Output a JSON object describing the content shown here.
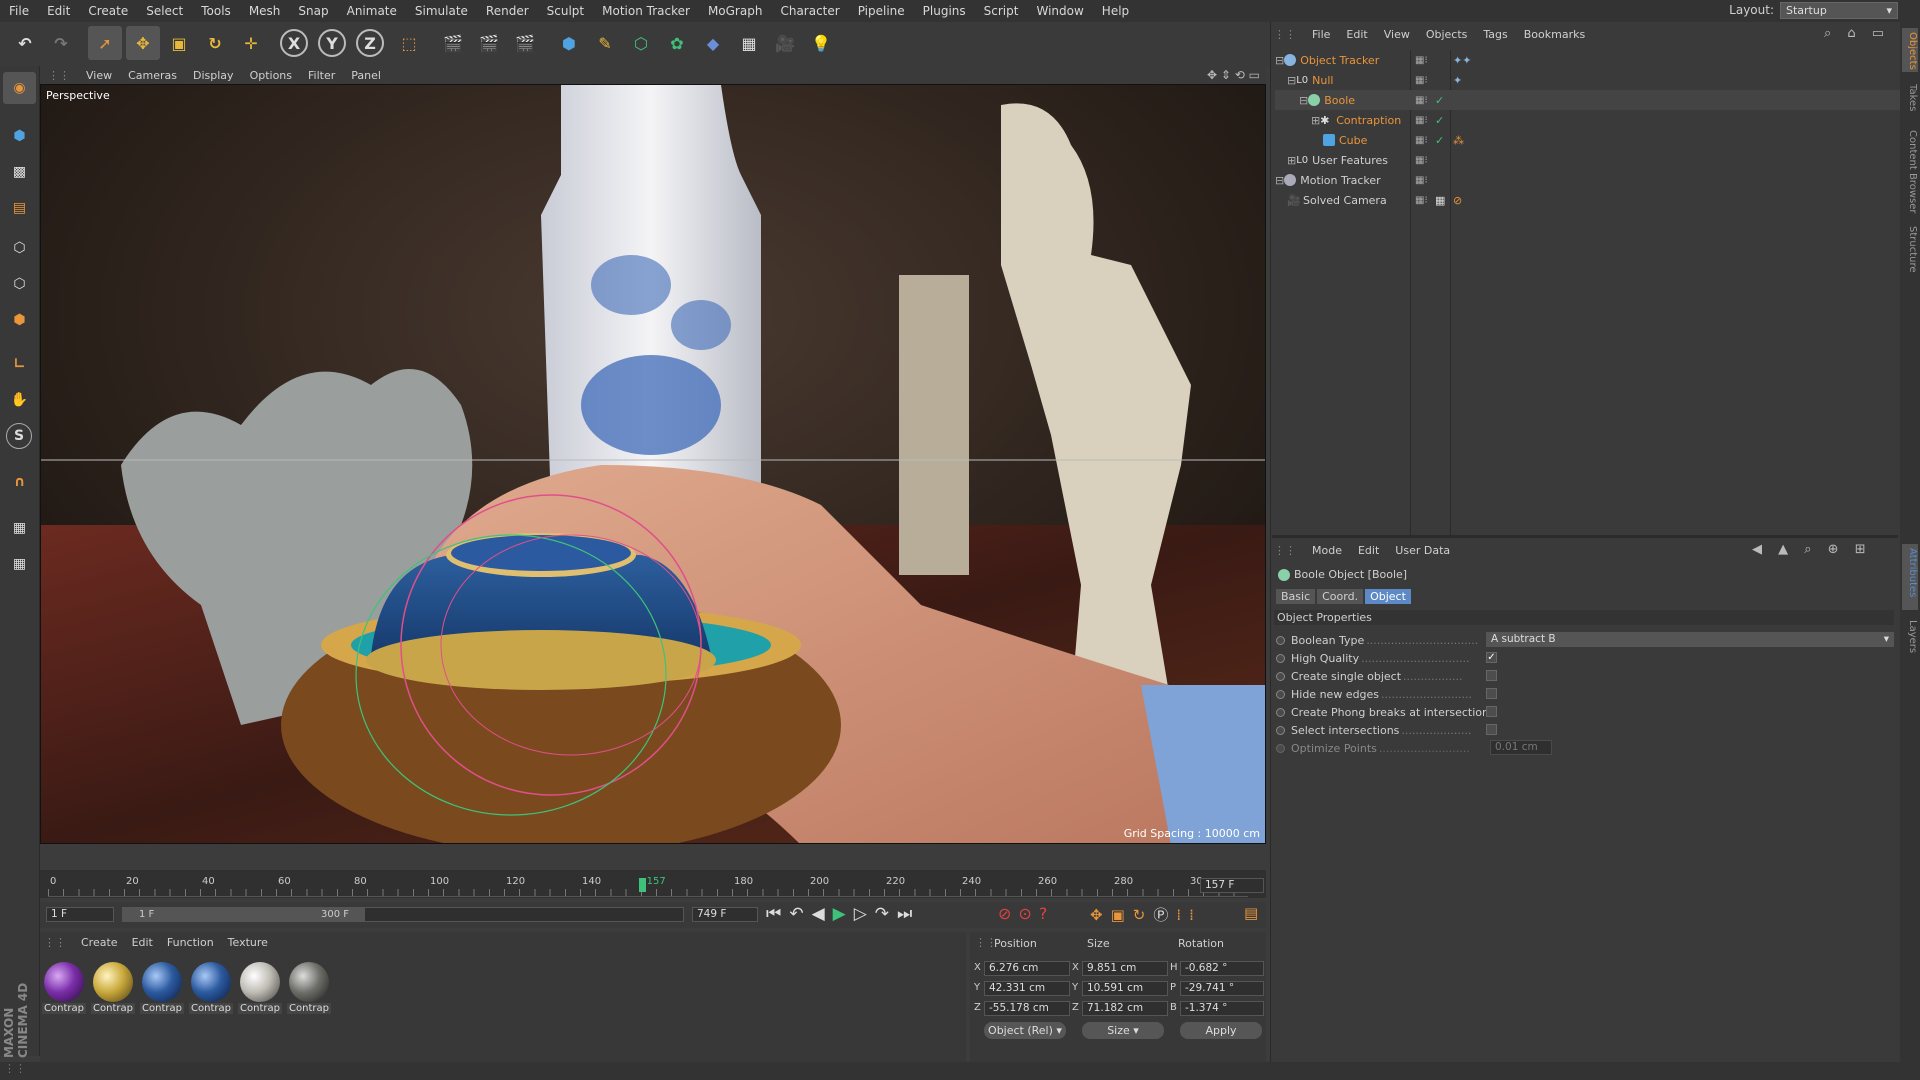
{
  "menubar": {
    "items": [
      "File",
      "Edit",
      "Create",
      "Select",
      "Tools",
      "Mesh",
      "Snap",
      "Animate",
      "Simulate",
      "Render",
      "Sculpt",
      "Motion Tracker",
      "MoGraph",
      "Character",
      "Pipeline",
      "Plugins",
      "Script",
      "Window",
      "Help"
    ],
    "layout_label": "Layout:",
    "layout_value": "Startup"
  },
  "toolbar": {
    "x_label": "X",
    "y_label": "Y",
    "z_label": "Z"
  },
  "viewport": {
    "menu": [
      "View",
      "Cameras",
      "Display",
      "Options",
      "Filter",
      "Panel"
    ],
    "label": "Perspective",
    "grid_spacing": "Grid Spacing : 10000 cm"
  },
  "timeline": {
    "ticks": [
      "0",
      "20",
      "40",
      "60",
      "80",
      "100",
      "120",
      "140",
      "157",
      "180",
      "200",
      "220",
      "240",
      "260",
      "280",
      "30"
    ],
    "end_frame": "157 F",
    "current_frame": 157,
    "max_frame": 300
  },
  "frame_ctrls": {
    "start": "1 F",
    "range_start": "1 F",
    "range_end": "300 F",
    "max": "749 F"
  },
  "materials": {
    "menu": [
      "Create",
      "Edit",
      "Function",
      "Texture"
    ],
    "items": [
      {
        "name": "Contrap",
        "color": "#7a2ea8"
      },
      {
        "name": "Contrap",
        "color": "#c9a93c"
      },
      {
        "name": "Contrap",
        "color": "#2c5aa0"
      },
      {
        "name": "Contrap",
        "color": "#2c5aa0"
      },
      {
        "name": "Contrap",
        "color": "#bfbcb4"
      },
      {
        "name": "Contrap",
        "color": "#6f6f6a"
      }
    ]
  },
  "coords": {
    "headers": [
      "Position",
      "Size",
      "Rotation"
    ],
    "rows": [
      {
        "axis": "X",
        "pos": "6.276 cm",
        "size_axis": "X",
        "size": "9.851 cm",
        "rot_axis": "H",
        "rot": "-0.682 °"
      },
      {
        "axis": "Y",
        "pos": "42.331 cm",
        "size_axis": "Y",
        "size": "10.591 cm",
        "rot_axis": "P",
        "rot": "-29.741 °"
      },
      {
        "axis": "Z",
        "pos": "-55.178 cm",
        "size_axis": "Z",
        "size": "71.182 cm",
        "rot_axis": "B",
        "rot": "-1.374 °"
      }
    ],
    "mode": "Object (Rel)",
    "size_mode": "Size",
    "apply": "Apply"
  },
  "object_manager": {
    "menu": [
      "File",
      "Edit",
      "View",
      "Objects",
      "Tags",
      "Bookmarks"
    ],
    "objects": [
      {
        "name": "Object Tracker",
        "indent": 0,
        "color": "#e8953b"
      },
      {
        "name": "Null",
        "indent": 1,
        "color": "#e8953b"
      },
      {
        "name": "Boole",
        "indent": 2,
        "color": "#e8953b"
      },
      {
        "name": "Contraption",
        "indent": 3,
        "color": "#e8953b"
      },
      {
        "name": "Cube",
        "indent": 3,
        "color": "#e8953b"
      },
      {
        "name": "User Features",
        "indent": 1,
        "color": "#d0d0d0"
      },
      {
        "name": "Motion Tracker",
        "indent": 0,
        "color": "#d0d0d0"
      },
      {
        "name": "Solved Camera",
        "indent": 1,
        "color": "#d0d0d0"
      }
    ]
  },
  "attributes": {
    "menu": [
      "Mode",
      "Edit",
      "User Data"
    ],
    "title": "Boole Object [Boole]",
    "tabs": [
      "Basic",
      "Coord.",
      "Object"
    ],
    "active_tab": "Object",
    "section": "Object Properties",
    "props": [
      {
        "label": "Boolean Type",
        "value": "A subtract B",
        "type": "select"
      },
      {
        "label": "High Quality",
        "checked": true,
        "type": "check"
      },
      {
        "label": "Create single object",
        "checked": false,
        "type": "check"
      },
      {
        "label": "Hide new edges",
        "checked": false,
        "type": "check"
      },
      {
        "label": "Create Phong breaks at intersections",
        "checked": false,
        "type": "check"
      },
      {
        "label": "Select intersections",
        "checked": false,
        "type": "check"
      },
      {
        "label": "Optimize Points",
        "value": "0.01 cm",
        "type": "field",
        "disabled": true
      }
    ]
  },
  "side_tabs": [
    "Objects",
    "Takes",
    "Content Browser",
    "Structure",
    "Attributes",
    "Layers"
  ],
  "branding": "MAXON CINEMA 4D",
  "colors": {
    "accent": "#e8953b",
    "active_blue": "#5d8ac7",
    "timeline_green": "#3ec27a"
  }
}
